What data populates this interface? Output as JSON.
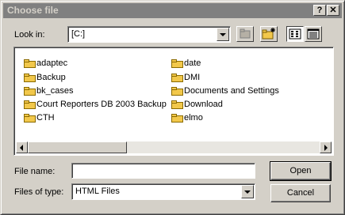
{
  "dialog": {
    "title": "Choose file",
    "help_symbol": "?",
    "close_symbol": "✕"
  },
  "look_in": {
    "label": "Look in:",
    "value": "[C:]"
  },
  "toolbar": {
    "up_folder_icon": "up-folder-icon",
    "new_folder_icon": "new-folder-icon",
    "list_view_icon": "list-view-icon",
    "details_view_icon": "details-view-icon"
  },
  "files": {
    "left_column": [
      "adaptec",
      "Backup",
      "bk_cases",
      "Court Reporters DB 2003 Backup",
      "CTH"
    ],
    "right_column": [
      "date",
      "DMI",
      "Documents and Settings",
      "Download",
      "elmo"
    ]
  },
  "file_name": {
    "label": "File name:",
    "value": ""
  },
  "file_type": {
    "label": "Files of type:",
    "value": "HTML Files"
  },
  "buttons": {
    "open": "Open",
    "cancel": "Cancel"
  },
  "colors": {
    "titlebar_inactive": "#808080",
    "face": "#d4d0c8",
    "folder": "#f2c84b"
  }
}
